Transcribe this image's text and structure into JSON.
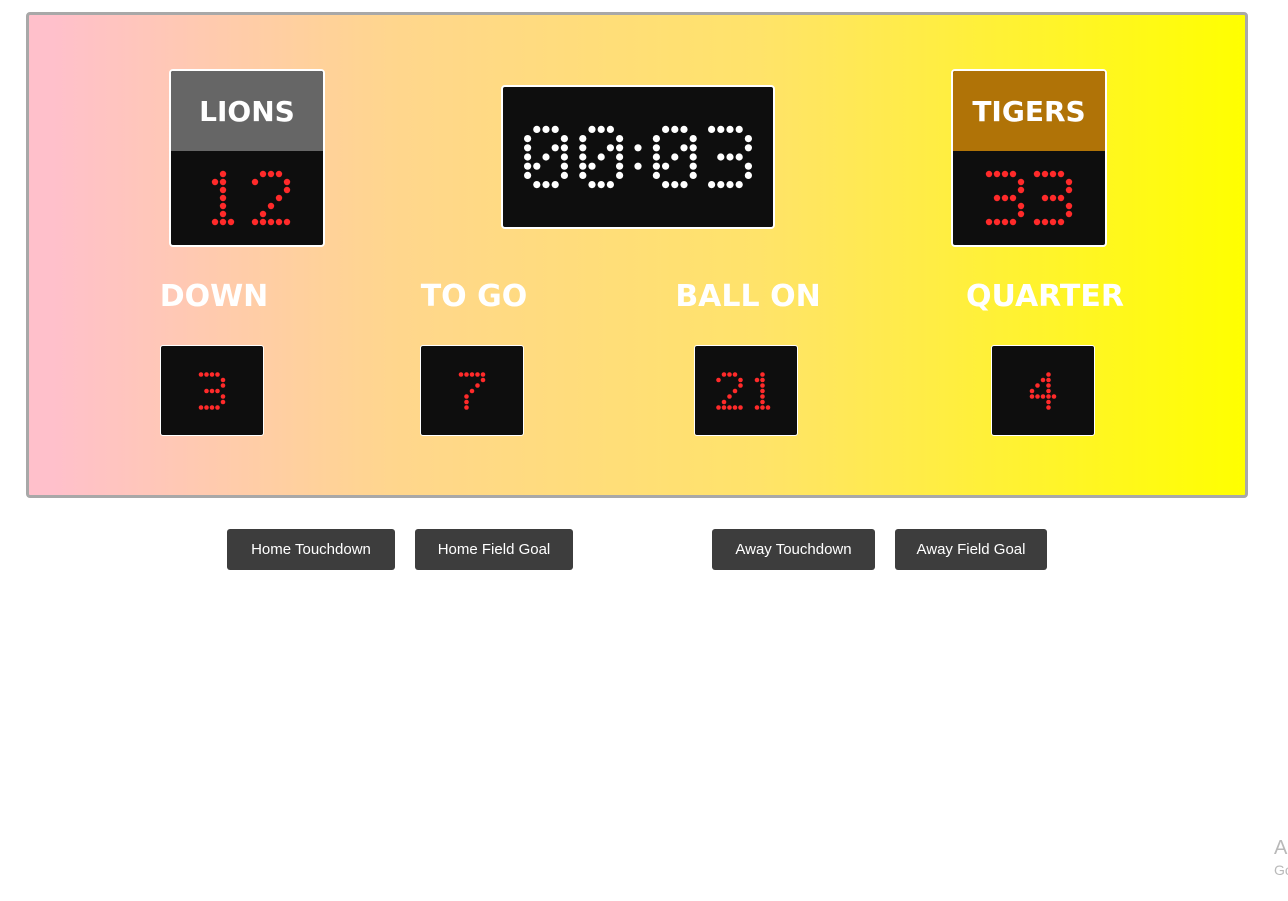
{
  "scoreboard": {
    "home": {
      "name": "LIONS",
      "score": "12",
      "header_color": "#666666"
    },
    "away": {
      "name": "TIGERS",
      "score": "33",
      "header_color": "#b07307"
    },
    "clock": "00:03",
    "stats": [
      {
        "label": "DOWN",
        "value": "3"
      },
      {
        "label": "TO GO",
        "value": "7"
      },
      {
        "label": "BALL ON",
        "value": "21"
      },
      {
        "label": "QUARTER",
        "value": "4"
      }
    ],
    "colors": {
      "score_led": "#ff2a2a",
      "clock_led": "#ffffff",
      "panel": "#0e0e0e"
    }
  },
  "controls": {
    "home_touchdown": "Home Touchdown",
    "home_field_goal": "Home Field Goal",
    "away_touchdown": "Away Touchdown",
    "away_field_goal": "Away Field Goal"
  },
  "watermark": {
    "line1": "Activate Windows",
    "line2": "Go to Settings to activate Windows."
  }
}
